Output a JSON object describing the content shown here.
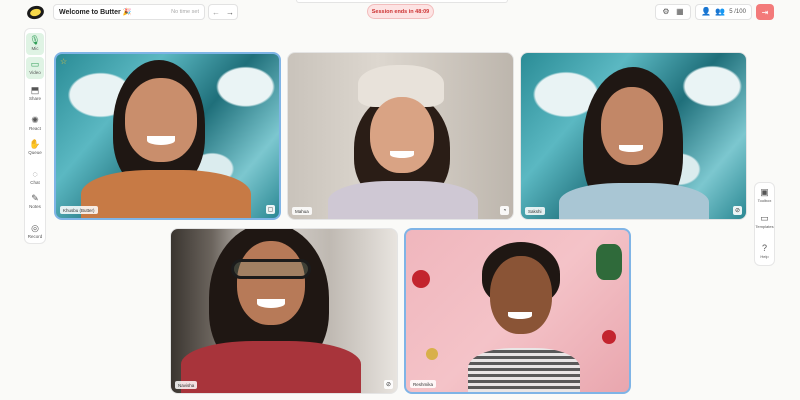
{
  "topbar": {
    "title": "Welcome to Butter 🎉",
    "timer": "No time set",
    "back_icon": "arrow-left-icon",
    "forward_icon": "arrow-right-icon",
    "session_text": "Session ends in 48:09",
    "participants_count": "5 /100",
    "exit_icon": "exit-icon"
  },
  "left_toolbar": [
    {
      "label": "Mic",
      "icon": "mic-icon",
      "active": true
    },
    {
      "label": "Video",
      "icon": "video-icon",
      "active": true
    },
    {
      "label": "Share",
      "icon": "share-screen-icon",
      "active": false
    },
    {
      "label": "React",
      "icon": "react-icon",
      "active": false
    },
    {
      "label": "Queue",
      "icon": "raise-hand-icon",
      "active": false
    },
    {
      "label": "Chat",
      "icon": "chat-icon",
      "active": false
    },
    {
      "label": "Notes",
      "icon": "notes-icon",
      "active": false
    },
    {
      "label": "Record",
      "icon": "record-icon",
      "active": false
    }
  ],
  "right_toolbar": [
    {
      "label": "Toolbox",
      "icon": "toolbox-icon"
    },
    {
      "label": "Templates",
      "icon": "templates-icon"
    },
    {
      "label": "Help",
      "icon": "help-icon"
    }
  ],
  "participants": [
    {
      "name": "Khusbu (Butter)",
      "background": "teal",
      "speaking": true,
      "host_star": true
    },
    {
      "name": "Mahua",
      "background": "room",
      "speaking": false,
      "host_star": false
    },
    {
      "name": "Sakshi",
      "background": "teal",
      "speaking": false,
      "host_star": false
    },
    {
      "name": "Navisha",
      "background": "door",
      "speaking": false,
      "host_star": false
    },
    {
      "name": "Reshmika",
      "background": "pink",
      "speaking": true,
      "host_star": false
    }
  ],
  "colors": {
    "accent_green": "#2f9e57",
    "speaking_border": "#7fb4e6",
    "session_pill": "#fde3e3",
    "exit_button": "#f37a7a"
  }
}
